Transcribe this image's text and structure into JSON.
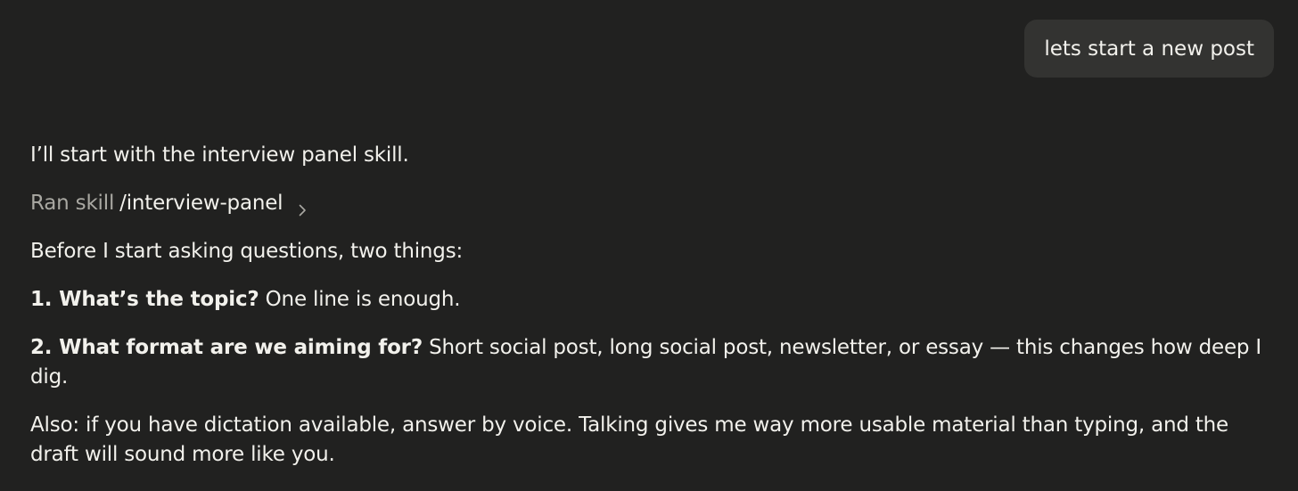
{
  "user_message": {
    "text": "lets start a new post"
  },
  "assistant": {
    "intro": "I’ll start with the interview panel skill.",
    "skill": {
      "prefix": "Ran skill",
      "name": "/interview-panel",
      "icon": "chevron-right-icon"
    },
    "lead": "Before I start asking questions, two things:",
    "questions": [
      {
        "bold": "1. What’s the topic?",
        "text": " One line is enough."
      },
      {
        "bold": "2. What format are we aiming for?",
        "text": " Short social post, long social post, newsletter, or essay — this changes how deep I dig."
      }
    ],
    "note": "Also: if you have dictation available, answer by voice. Talking gives me way more usable material than typing, and the draft will sound more like you."
  },
  "colors": {
    "background": "#212120",
    "bubble": "#333331",
    "text": "#f2f1ec",
    "muted": "#a9a8a2"
  }
}
